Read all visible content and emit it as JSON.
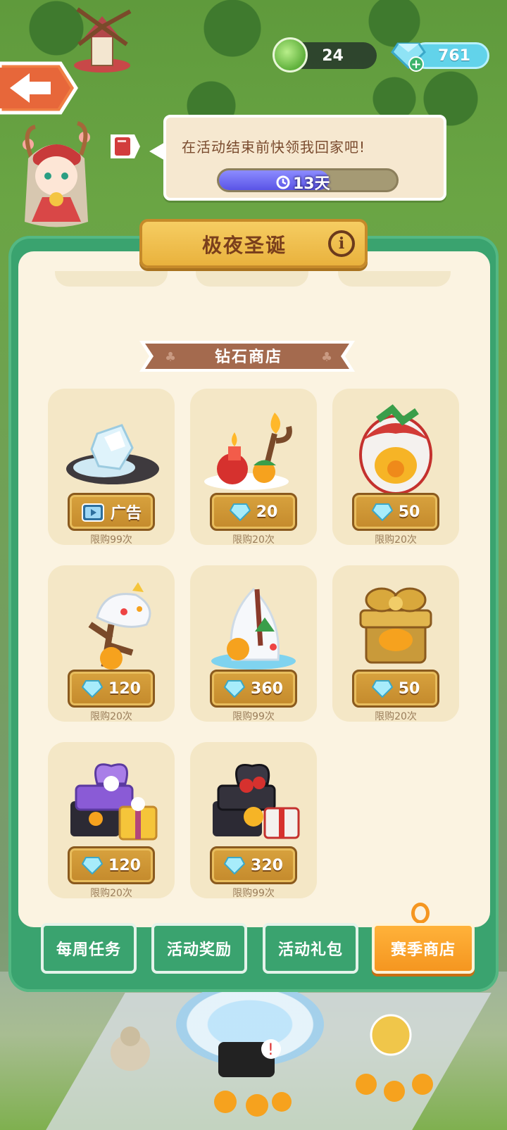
{
  "resources": {
    "energy": "24",
    "gems": "761"
  },
  "speech": {
    "message": "在活动结束前快领我回家吧!",
    "timer": "13天"
  },
  "panel": {
    "title": "极夜圣诞",
    "section_title": "钻石商店"
  },
  "shop_items": [
    {
      "price": "广告",
      "currency": "ad",
      "limit": "限购99次",
      "art": "ice-crystal"
    },
    {
      "price": "20",
      "currency": "gem",
      "limit": "限购20次",
      "art": "candle-fire"
    },
    {
      "price": "50",
      "currency": "gem",
      "limit": "限购20次",
      "art": "christmas-egg"
    },
    {
      "price": "120",
      "currency": "gem",
      "limit": "限购20次",
      "art": "snowy-branch"
    },
    {
      "price": "360",
      "currency": "gem",
      "limit": "限购99次",
      "art": "snowy-tree"
    },
    {
      "price": "50",
      "currency": "gem",
      "limit": "限购20次",
      "art": "gold-gift"
    },
    {
      "price": "120",
      "currency": "gem",
      "limit": "限购20次",
      "art": "purple-gifts"
    },
    {
      "price": "320",
      "currency": "gem",
      "limit": "限购99次",
      "art": "black-gifts"
    }
  ],
  "tabs": [
    {
      "label": "每周任务",
      "active": false
    },
    {
      "label": "活动奖励",
      "active": false
    },
    {
      "label": "活动礼包",
      "active": false
    },
    {
      "label": "赛季商店",
      "active": true
    }
  ],
  "colors": {
    "panel_green": "#3aa36f",
    "panel_cream": "#fbf3e1",
    "card_bg": "#f4e7c6",
    "price_gold": "#c48a2c",
    "tab_active_orange": "#f59620",
    "gem_blue": "#62d3ea"
  }
}
